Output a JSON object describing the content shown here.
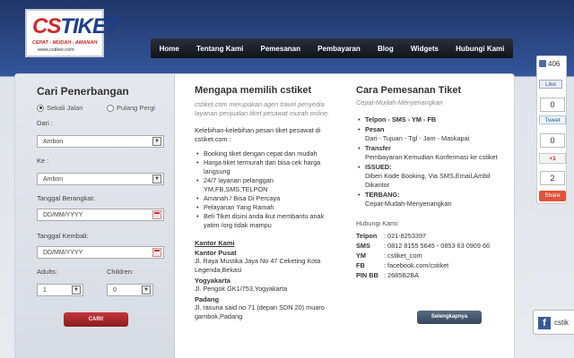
{
  "logo": {
    "main": "CSTIKET",
    "tagline": "CEPAT - MUDAH - AMANAH",
    "url": "www.cstiket.com"
  },
  "nav": [
    "Home",
    "Tentang Kami",
    "Pemesanan",
    "Pembayaran",
    "Blog",
    "Widgets",
    "Hubungi Kami"
  ],
  "search": {
    "title": "Cari Penerbangan",
    "trip_options": [
      "Sekali Jalan",
      "Pulang Pergi"
    ],
    "selected_trip": "Sekali Jalan",
    "from_label": "Dari :",
    "from_value": "Ambon",
    "to_label": "Ke :",
    "to_value": "Ambon",
    "depart_label": "Tanggal Berangkat:",
    "depart_value": "DD/MM/YYYY",
    "return_label": "Tanggal Kembali:",
    "return_value": "DD/MM/YYYY",
    "adults_label": "Adults:",
    "adults_value": "1",
    "children_label": "Children:",
    "children_value": "0",
    "submit": "CARI!"
  },
  "why": {
    "title": "Mengapa memilih cstiket",
    "intro": "cstiket.com merupakan agen travel penyedia layanan penjualan tiket pesawat murah online.",
    "lead": "Kelebihan-kelebihan pesan tiket pesawat di cstiket.com :",
    "points": [
      "Booking tiket dengan cepat dan mudah",
      "Harga tiket termurah dan bisa cek harga langsung",
      "24/7 layanan pelanggan YM,FB,SMS,TELPON",
      "Amanah / Bisa Di Percaya",
      "Pelayanan Yang Ramah",
      "Beli Tiket disini anda ikut membantu anak yatim /org tidak mampu"
    ],
    "office_heading": "Kantor Kami",
    "offices": [
      {
        "name": "Kantor Pusat",
        "address": "Jl. Raya Mustika Jaya No 47 Ceketing Kota Legenda,Bekasi"
      },
      {
        "name": "Yogyakarta",
        "address": "Jl. Pengok GK1/753,Yogyakarta"
      },
      {
        "name": "Padang",
        "address": "Jl. rasuna said no 71 (depan SDN 20) muaro gambok,Padang"
      }
    ]
  },
  "howto": {
    "title": "Cara Pemesanan Tiket",
    "subtitle": "Cepat-Mudah-Menyenangkan",
    "steps": [
      {
        "title": "Telpon - SMS - YM - FB",
        "desc": ""
      },
      {
        "title": "Pesan",
        "desc": "Dari - Tujuan - Tgl - Jam - Maskapai"
      },
      {
        "title": "Transfer",
        "desc": "Pembayaran Kemudian Konfermasi ke cstiket"
      },
      {
        "title": "ISSUED:",
        "desc": "Diberi Kode Booking, Via SMS,Email,Ambil Dikantor"
      },
      {
        "title": "TERBANG:",
        "desc": "Cepat-Mudah-Menyenangkan"
      }
    ],
    "contact_heading": "Hubungi Kami:",
    "contacts": [
      {
        "k": "Telpon",
        "v": ": 021-8253397"
      },
      {
        "k": "SMS",
        "v": ": 0812 8155 5645 - 0853 63 0909 66"
      },
      {
        "k": "YM",
        "v": ": cstiket_com"
      },
      {
        "k": "FB",
        "v": ": facebook.com/cstiket"
      },
      {
        "k": "PIN BB",
        "v": ": 2685B2BA"
      }
    ],
    "more_button": "Selengkapnya"
  },
  "social": {
    "fb_count": "406",
    "like": "Like",
    "fb_box": "0",
    "tweet": "Tweet",
    "tw_box": "0",
    "gplus": "+1",
    "gp_box": "2",
    "share": "Share"
  },
  "fb_badge": {
    "text": "cstik"
  }
}
